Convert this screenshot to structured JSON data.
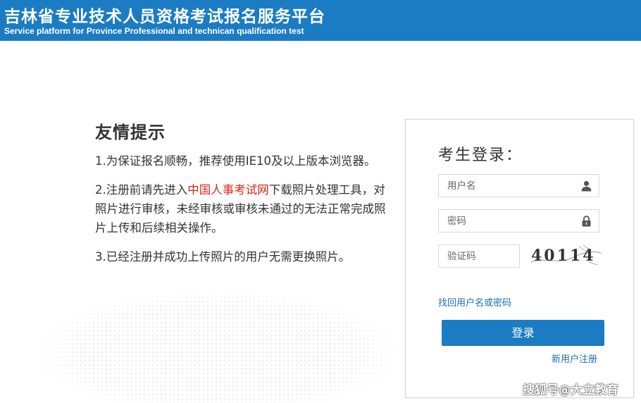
{
  "header": {
    "title": "吉林省专业技术人员资格考试报名服务平台",
    "subtitle": "Service platform for Province Professional and technican qualification test"
  },
  "tips": {
    "heading": "友情提示",
    "item1": "1.为保证报名顺畅，推荐使用IE10及以上版本浏览器。",
    "item2_before": "2.注册前请先进入",
    "item2_link": "中国人事考试网",
    "item2_after": "下载照片处理工具，对照片进行审核，未经审核或审核未通过的无法正常完成照片上传和后续相关操作。",
    "item3": "3.已经注册并成功上传照片的用户无需更换照片。"
  },
  "login": {
    "title": "考生登录：",
    "username_placeholder": "用户名",
    "password_placeholder": "密码",
    "captcha_placeholder": "验证码",
    "captcha_text": "40114",
    "forgot_link": "找回用户名或密码",
    "login_button": "登录",
    "register_link": "新用户注册"
  },
  "watermark": "搜狐号@大立教育",
  "colors": {
    "brand_blue": "#1b7cc4",
    "link_red": "#d9261c",
    "link_blue": "#1b6fb8"
  },
  "icons": {
    "username": "user-icon",
    "password": "lock-icon"
  }
}
